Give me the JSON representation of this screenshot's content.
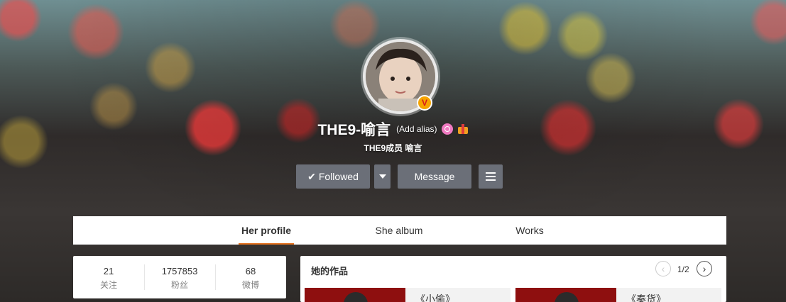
{
  "profile": {
    "username": "THE9-喻言",
    "alias_link": "(Add alias)",
    "bio": "THE9成员 喻言",
    "verified_badge": "V"
  },
  "actions": {
    "followed_label": "Followed",
    "message_label": "Message"
  },
  "tabs": [
    {
      "label": "Her profile",
      "active": true
    },
    {
      "label": "She album",
      "active": false
    },
    {
      "label": "Works",
      "active": false
    }
  ],
  "stats": [
    {
      "value": "21",
      "label": "关注"
    },
    {
      "value": "1757853",
      "label": "粉丝"
    },
    {
      "value": "68",
      "label": "微博"
    }
  ],
  "works": {
    "title": "她的作品",
    "page": "1/2",
    "items": [
      {
        "title": "《小偷》"
      },
      {
        "title": "《秦货》"
      }
    ]
  },
  "colors": {
    "tab_active_underline": "#e5721f",
    "button_bg": "#6b6f78",
    "verified": "#f6a400"
  },
  "icons": [
    "check-icon",
    "chevron-down-icon",
    "menu-icon",
    "verified-icon",
    "alias-icon",
    "gift-icon",
    "prev-arrow-icon",
    "next-arrow-icon"
  ]
}
